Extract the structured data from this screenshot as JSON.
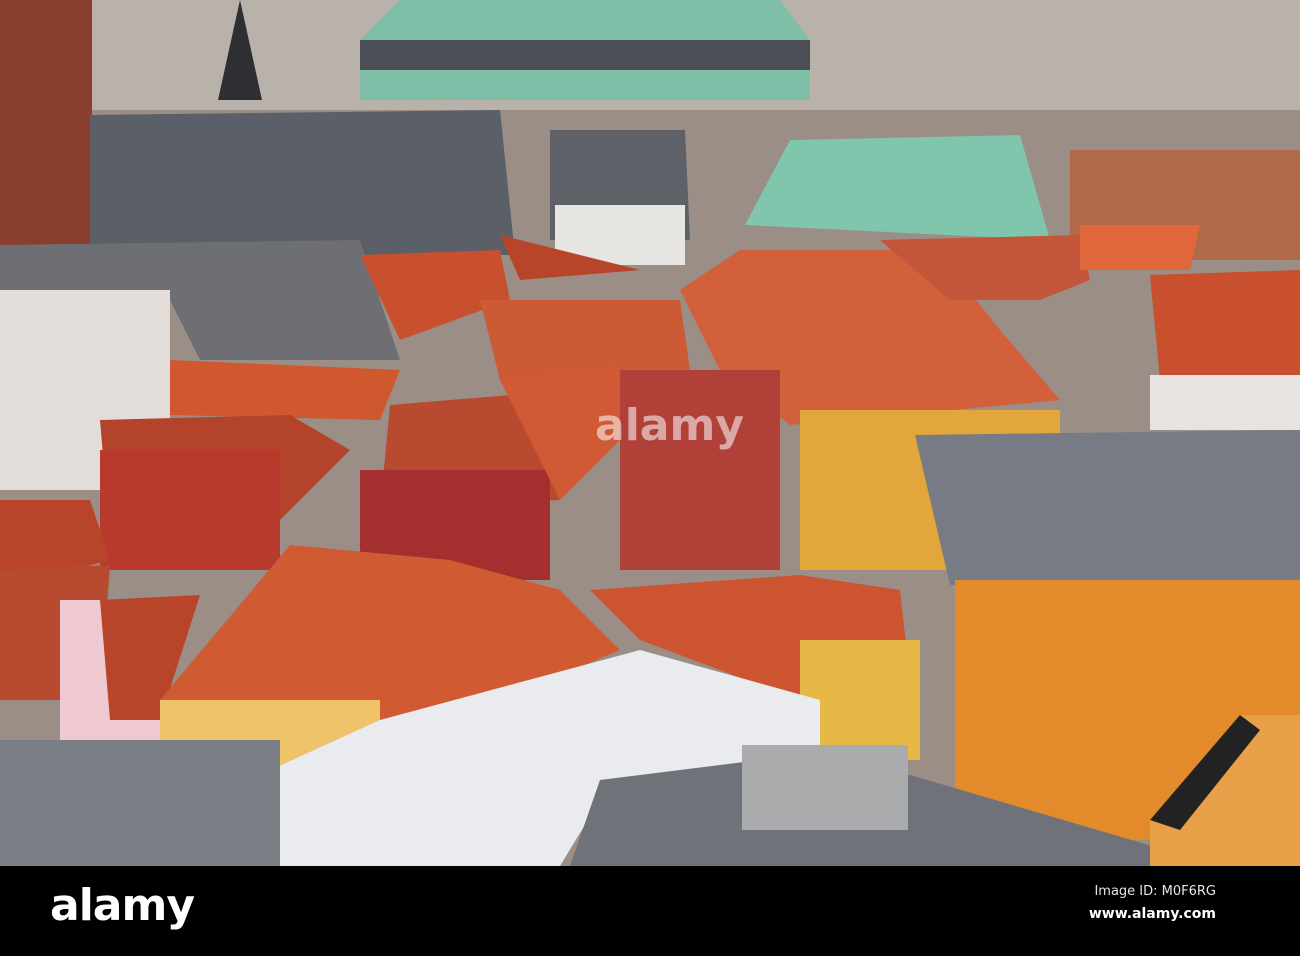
{
  "photo": {
    "subject": "rooftops"
  },
  "watermark": "alamy",
  "footer": {
    "logo": "alamy",
    "image_id": "Image ID: M0F6RG",
    "url": "www.alamy.com"
  },
  "colors": {
    "roof_tile": "#c8502e",
    "copper_roof": "#7fbfa8",
    "slate": "#6b6f76",
    "footer": "#000000"
  }
}
